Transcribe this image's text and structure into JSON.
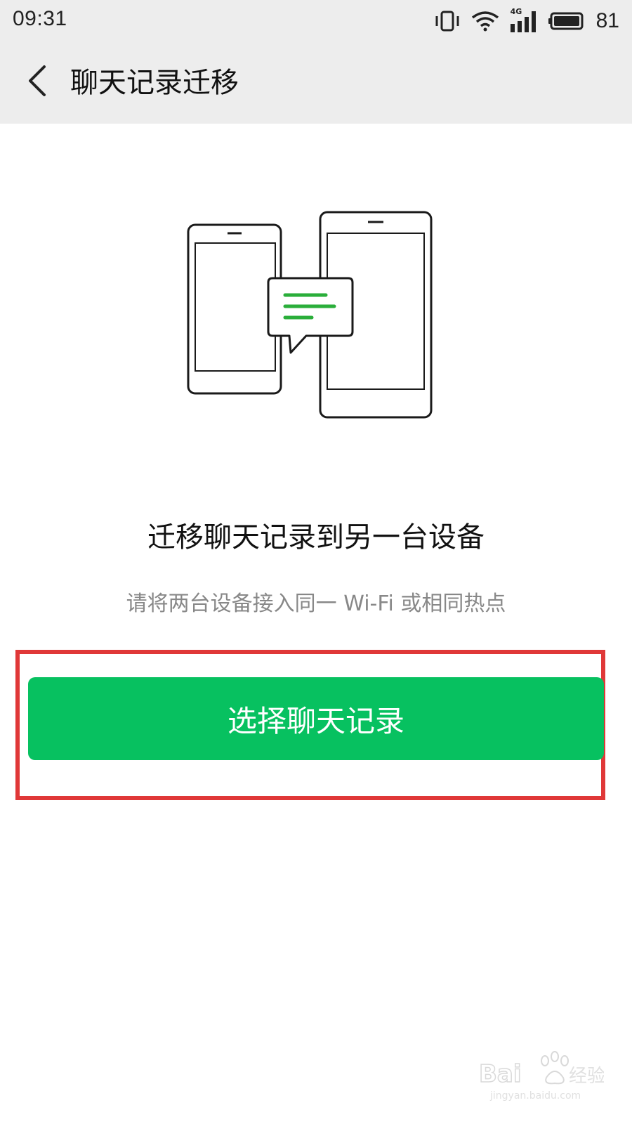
{
  "status_bar": {
    "time": "09:31",
    "network_label": "4G",
    "battery_level": "81",
    "icons": [
      "vibrate-icon",
      "wifi-icon",
      "cellular-signal-icon",
      "battery-icon"
    ]
  },
  "nav": {
    "back_icon": "chevron-left-icon",
    "title": "聊天记录迁移"
  },
  "main": {
    "illustration": "two-phones-transfer-illustration",
    "heading": "迁移聊天记录到另一台设备",
    "subtitle": "请将两台设备接入同一 Wi-Fi 或相同热点",
    "primary_button_label": "选择聊天记录"
  },
  "watermark": {
    "brand": "Baidu经验",
    "url": "jingyan.baidu.com"
  },
  "colors": {
    "nav_background": "#ededed",
    "accent_green": "#07c160",
    "highlight_red": "#e03838",
    "subtitle_gray": "#888888"
  }
}
